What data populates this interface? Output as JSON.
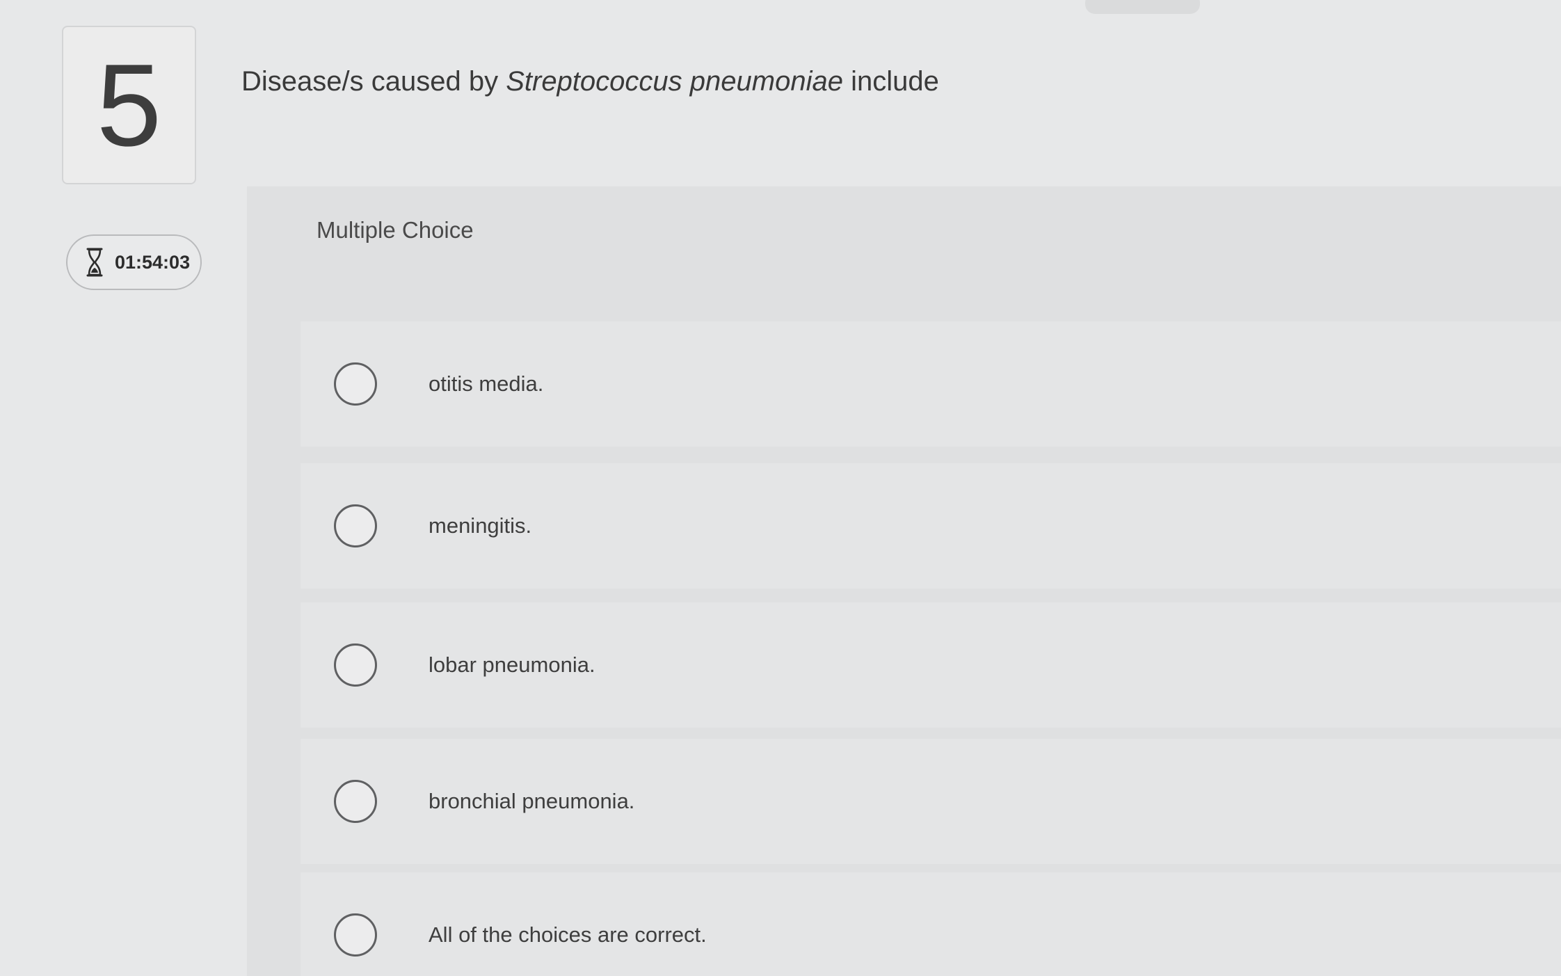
{
  "question": {
    "number": "5",
    "stem_prefix": "Disease/s caused by ",
    "stem_italic": "Streptococcus pneumoniae",
    "stem_suffix": " include",
    "type_label": "Multiple Choice"
  },
  "timer": {
    "icon": "hourglass-icon",
    "time": "01:54:03"
  },
  "choices": [
    {
      "label": "otitis media."
    },
    {
      "label": "meningitis."
    },
    {
      "label": "lobar pneumonia."
    },
    {
      "label": "bronchial pneumonia."
    },
    {
      "label": "All of the choices are correct."
    }
  ],
  "colors": {
    "background": "#e7e8e9",
    "panel": "#dfe0e1",
    "text": "#3a3a3a",
    "radio_border": "#5f6062"
  }
}
